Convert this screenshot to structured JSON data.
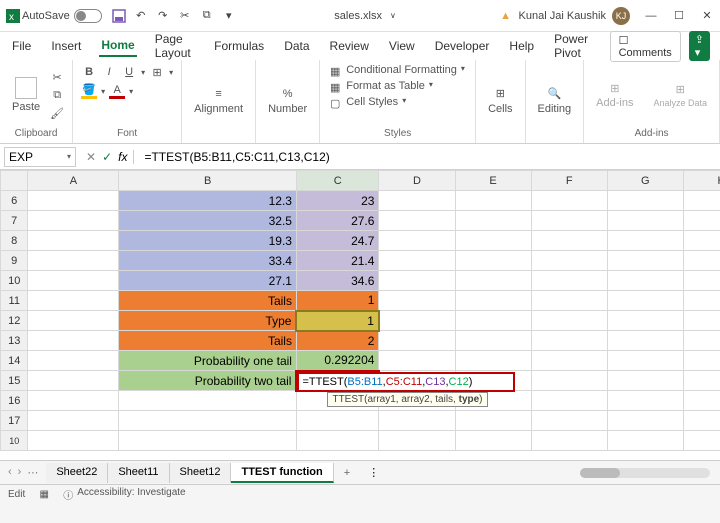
{
  "titlebar": {
    "autosave": "AutoSave",
    "filename": "sales.xlsx",
    "user": "Kunal Jai Kaushik",
    "initials": "KJ"
  },
  "tabs": [
    "File",
    "Insert",
    "Home",
    "Page Layout",
    "Formulas",
    "Data",
    "Review",
    "View",
    "Developer",
    "Help",
    "Power Pivot"
  ],
  "active_tab": "Home",
  "comments": "Comments",
  "ribbon": {
    "clipboard": "Clipboard",
    "paste": "Paste",
    "font": "Font",
    "alignment": "Alignment",
    "number": "Number",
    "styles": "Styles",
    "cells": "Cells",
    "editing": "Editing",
    "addins": "Add-ins",
    "analyze": "Analyze Data",
    "cf": "Conditional Formatting",
    "fat": "Format as Table",
    "cs": "Cell Styles"
  },
  "namebox": "EXP",
  "formula": "=TTEST(B5:B11,C5:C11,C13,C12)",
  "cols": [
    "A",
    "B",
    "C",
    "D",
    "E",
    "F",
    "G",
    "H"
  ],
  "rows": [
    {
      "n": 6,
      "b": "12.3",
      "c": "23",
      "cls": "purple"
    },
    {
      "n": 7,
      "b": "32.5",
      "c": "27.6",
      "cls": "purple"
    },
    {
      "n": 8,
      "b": "19.3",
      "c": "24.7",
      "cls": "purple"
    },
    {
      "n": 9,
      "b": "33.4",
      "c": "21.4",
      "cls": "purple"
    },
    {
      "n": 10,
      "b": "27.1",
      "c": "34.6",
      "cls": "purple"
    },
    {
      "n": 11,
      "b": "Tails",
      "c": "1",
      "cls": "orange"
    },
    {
      "n": 12,
      "b": "Type",
      "c": "1",
      "cls": "orange",
      "ysel": true
    },
    {
      "n": 13,
      "b": "Tails",
      "c": "2",
      "cls": "orange"
    },
    {
      "n": 14,
      "b": "Probability one tail",
      "c": "0.292204",
      "cls": "green"
    },
    {
      "n": 15,
      "b": "Probability two tail",
      "c": "",
      "cls": "formula"
    },
    {
      "n": 16,
      "b": "",
      "c": "",
      "cls": "blank"
    },
    {
      "n": 17,
      "b": "",
      "c": "",
      "cls": "blank"
    }
  ],
  "cell_formula": {
    "pre": "=TTEST(",
    "a1": "B5:B11",
    "a2": "C5:C11",
    "a3": "C13",
    "a4": "C12",
    "post": ")"
  },
  "tooltip": "TTEST(array1, array2, tails, type)",
  "sheets": [
    "Sheet22",
    "Sheet11",
    "Sheet12",
    "TTEST function"
  ],
  "active_sheet": "TTEST function",
  "status": {
    "mode": "Edit",
    "acc": "Accessibility: Investigate"
  }
}
